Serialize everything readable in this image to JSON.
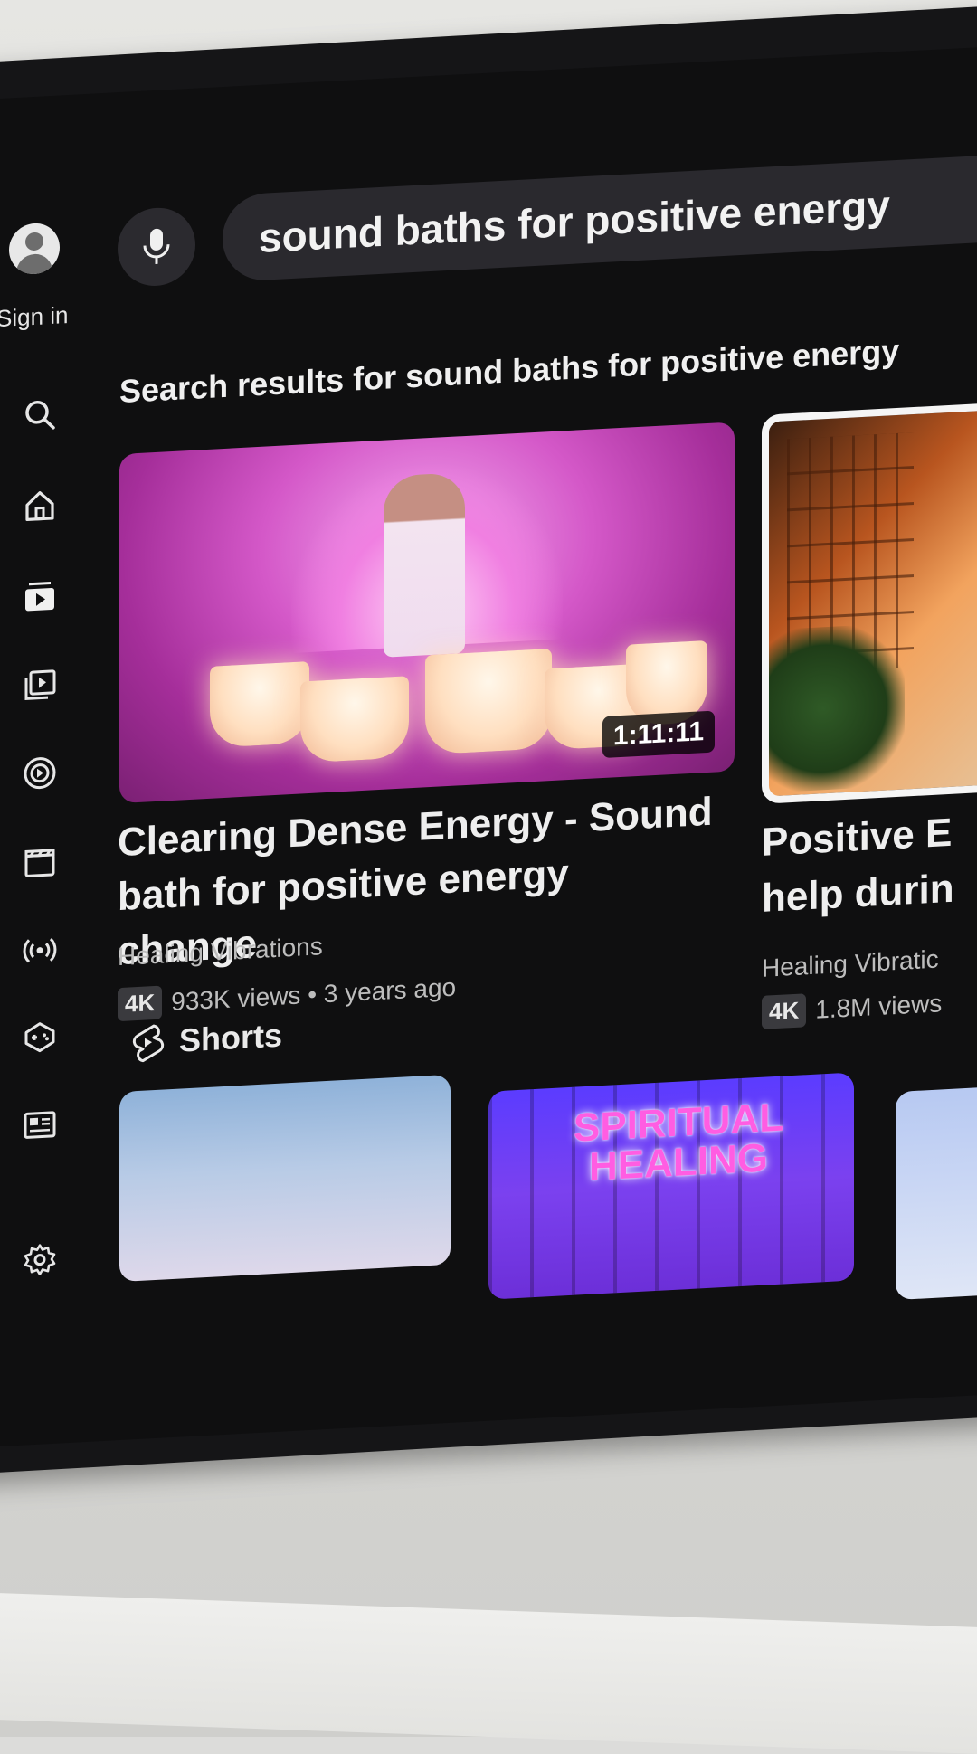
{
  "sidebar": {
    "sign_in_label": "Sign in",
    "items": [
      {
        "icon": "search-icon"
      },
      {
        "icon": "home-icon"
      },
      {
        "icon": "subscriptions-icon"
      },
      {
        "icon": "library-icon"
      },
      {
        "icon": "youtube-music-icon"
      },
      {
        "icon": "movies-icon"
      },
      {
        "icon": "live-icon"
      },
      {
        "icon": "gaming-icon"
      },
      {
        "icon": "news-icon"
      },
      {
        "icon": "settings-icon"
      }
    ]
  },
  "search": {
    "query": "sound baths for positive energy"
  },
  "results": {
    "heading": "Search results for sound baths for positive energy",
    "videos": [
      {
        "title": "Clearing Dense Energy - Sound bath for positive energy change",
        "channel": "Healing Vibrations",
        "badge": "4K",
        "views": "933K views",
        "age": "3 years ago",
        "meta": "933K views • 3 years ago",
        "duration": "1:11:11"
      },
      {
        "title_line1": "Positive E",
        "title_line2": "help durin",
        "channel": "Healing Vibratic",
        "badge": "4K",
        "meta": "1.8M views"
      }
    ]
  },
  "shorts": {
    "label": "Shorts",
    "items": [
      {
        "text": ""
      },
      {
        "text": "SPIRITUAL HEALING"
      },
      {
        "text": ""
      }
    ]
  },
  "colors": {
    "screen_bg": "#0f0f10",
    "pill_bg": "#2a292e",
    "thumb_pink": "#d458c8",
    "focus_border": "#f5f5f5"
  }
}
